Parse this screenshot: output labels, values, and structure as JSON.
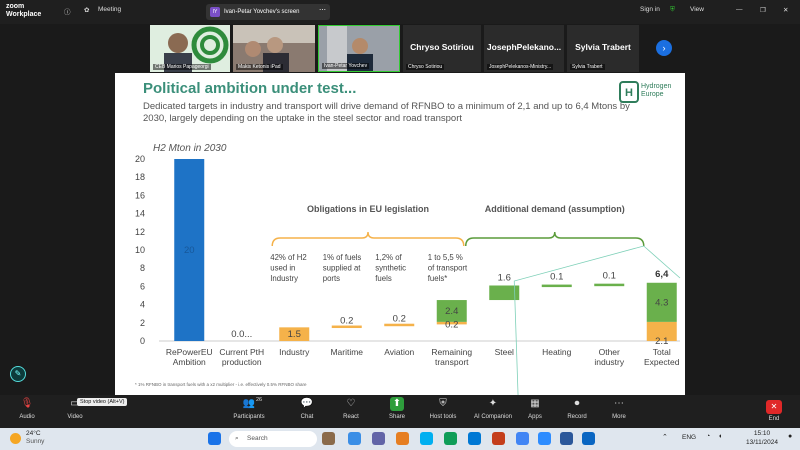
{
  "app": {
    "logo_line1": "zoom",
    "logo_line2": "Workplace"
  },
  "titlebar": {
    "meeting_label": "Meeting",
    "share_label": "Ivan-Petar Yovchev's screen",
    "share_avatar": "IY",
    "signin_label": "Sign in",
    "view_label": "View"
  },
  "participants_strip": [
    {
      "name": "CEB Marios Papageorgi"
    },
    {
      "name": "Makis Ketonis iPad"
    },
    {
      "name": "Ivan-Petar Yovchev"
    },
    {
      "name": "Chryso Sotiriou",
      "display": "Chryso Sotiriou"
    },
    {
      "name": "JosephPelekanos-Ministry...",
      "display": "JosephPelekano..."
    },
    {
      "name": "Sylvia Trabert",
      "display": "Sylvia Trabert"
    }
  ],
  "slide": {
    "title": "Political ambition under test...",
    "subtitle": "Dedicated targets in industry and transport will drive demand of RFNBO to a minimum of 2,1 and up to 6,4 Mtons by 2030, largely depending on the uptake in the steel sector and road transport",
    "logo_line1": "Hydrogen",
    "logo_line2": "Europe",
    "footnote": "* 1% RFNBO in transport fuels with a x2 multiplier - i.e. effectively 0.5% RFNBO share"
  },
  "chart_data": {
    "type": "bar",
    "ylabel": "H2 Mton in 2030",
    "ylim": [
      0,
      20
    ],
    "yticks": [
      0,
      2,
      4,
      6,
      8,
      10,
      12,
      14,
      16,
      18,
      20
    ],
    "categories": [
      "RePowerEU Ambition",
      "Current PtH production",
      "Industry",
      "Maritime",
      "Aviation",
      "Remaining transport",
      "Steel",
      "Heating",
      "Other industry",
      "Total Expected"
    ],
    "category_lines": [
      [
        "RePowerEU",
        "Ambition"
      ],
      [
        "Current PtH",
        "production"
      ],
      [
        "Industry"
      ],
      [
        "Maritime"
      ],
      [
        "Aviation"
      ],
      [
        "Remaining",
        "transport"
      ],
      [
        "Steel"
      ],
      [
        "Heating"
      ],
      [
        "Other",
        "industry"
      ],
      [
        "Total",
        "Expected"
      ]
    ],
    "bars": [
      {
        "base": 0,
        "value": 20,
        "label": "20",
        "color": "#1e73c6"
      },
      {
        "base": 0,
        "value": 0.0,
        "label": "0.0...",
        "color": "#f5b24a"
      },
      {
        "base": 0,
        "value": 1.5,
        "label": "1.5",
        "color": "#f5b24a"
      },
      {
        "base": 1.5,
        "value": 0.2,
        "label": "0.2",
        "color": "#f5b24a"
      },
      {
        "base": 1.7,
        "value": 0.2,
        "label": "0.2",
        "color": "#f5b24a"
      },
      {
        "base": 1.9,
        "value": 0.2,
        "label": "0.2",
        "color": "#f5b24a",
        "extra": {
          "value": 2.4,
          "label": "2.4",
          "color": "#6ab04c"
        }
      },
      {
        "base": 4.5,
        "value": 1.6,
        "label": "1.6",
        "color": "#6ab04c",
        "label_above": true
      },
      {
        "base": 6.1,
        "value": 0.1,
        "label": "0.1",
        "color": "#6ab04c",
        "label_above": true
      },
      {
        "base": 6.2,
        "value": 0.1,
        "label": "0.1",
        "color": "#6ab04c",
        "label_above": true
      },
      {
        "base": 0,
        "value": 2.1,
        "label": "2.1",
        "color": "#f5b24a",
        "extra": {
          "value": 4.3,
          "label": "4.3",
          "color": "#6ab04c"
        },
        "total_label": "6,4"
      }
    ],
    "obligations_title": "Obligations in EU legislation",
    "obligations_notes": [
      [
        "42% of H2",
        "used in",
        "Industry"
      ],
      [
        "1% of fuels",
        "supplied at",
        "ports"
      ],
      [
        "1,2% of",
        "synthetic",
        "fuels"
      ],
      [
        "1 to 5,5 %",
        "of transport",
        "fuels*"
      ]
    ],
    "additional_title": "Additional demand (assumption)"
  },
  "toolbar": {
    "items": [
      {
        "label": "Audio",
        "icon": "mic-muted-icon"
      },
      {
        "label": "Video",
        "icon": "video-icon"
      },
      {
        "label": "Participants",
        "icon": "participants-icon",
        "count": "26"
      },
      {
        "label": "Chat",
        "icon": "chat-icon"
      },
      {
        "label": "React",
        "icon": "react-icon"
      },
      {
        "label": "Share",
        "icon": "share-icon"
      },
      {
        "label": "Host tools",
        "icon": "host-tools-icon"
      },
      {
        "label": "AI Companion",
        "icon": "ai-companion-icon"
      },
      {
        "label": "Apps",
        "icon": "apps-icon"
      },
      {
        "label": "Record",
        "icon": "record-icon"
      },
      {
        "label": "More",
        "icon": "more-icon"
      }
    ],
    "tooltip": "Stop video (Alt+V)",
    "end_label": "End"
  },
  "taskbar": {
    "weather_temp": "24°C",
    "weather_desc": "Sunny",
    "search_placeholder": "Search",
    "lang": "ENG",
    "time": "15:10",
    "date": "13/11/2024"
  },
  "colors": {
    "accent_teal": "#3b8f7a",
    "blue": "#1e73c6",
    "orange": "#f5b24a",
    "green": "#6ab04c"
  }
}
